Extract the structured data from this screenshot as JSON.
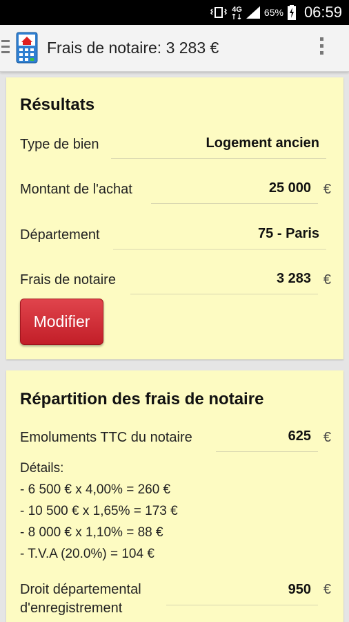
{
  "statusbar": {
    "network": "4G",
    "battery_pct": "65%",
    "time": "06:59"
  },
  "actionbar": {
    "title": "Frais de notaire: 3 283 €"
  },
  "results": {
    "title": "Résultats",
    "type_bien": {
      "label": "Type de bien",
      "value": "Logement ancien"
    },
    "montant": {
      "label": "Montant de l'achat",
      "value": "25 000",
      "unit": "€"
    },
    "departement": {
      "label": "Département",
      "value": "75 - Paris"
    },
    "frais": {
      "label": "Frais de notaire",
      "value": "3 283",
      "unit": "€"
    },
    "modify_label": "Modifier"
  },
  "repartition": {
    "title": "Répartition des frais de notaire",
    "emoluments": {
      "label": "Emoluments TTC du notaire",
      "value": "625",
      "unit": "€"
    },
    "details_title": "Détails:",
    "details": [
      "- 6 500 € x 4,00% = 260 €",
      "- 10 500 € x 1,65% = 173 €",
      "- 8 000 € x 1,10% = 88 €",
      "- T.V.A (20.0%) = 104 €"
    ],
    "droit": {
      "label_line1": "Droit départemental",
      "label_line2": "d'enregistrement",
      "value": "950",
      "unit": "€"
    }
  },
  "colors": {
    "card_bg": "#fdfbc2",
    "button_red": "#d0303a"
  }
}
